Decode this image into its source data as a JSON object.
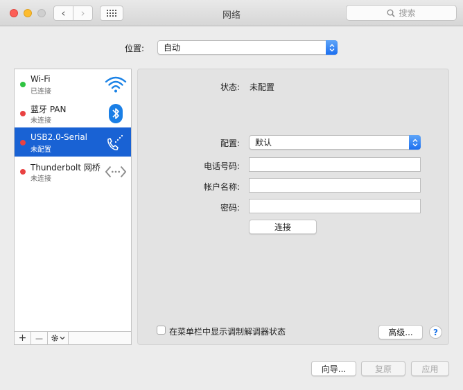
{
  "window": {
    "title": "网络",
    "search_placeholder": "搜索"
  },
  "titlebar_icons": {
    "back": "‹",
    "forward": "›"
  },
  "location": {
    "label": "位置:",
    "value": "自动"
  },
  "services": [
    {
      "name": "Wi-Fi",
      "status": "已连接",
      "status_color": "#2fc442",
      "icon": "wifi-icon"
    },
    {
      "name": "蓝牙 PAN",
      "status": "未连接",
      "status_color": "#e94242",
      "icon": "bluetooth-icon"
    },
    {
      "name": "USB2.0-Serial",
      "status": "未配置",
      "status_color": "#e94242",
      "icon": "phone-modem-icon",
      "selected": true
    },
    {
      "name": "Thunderbolt 网桥",
      "status": "未连接",
      "status_color": "#e94242",
      "icon": "bridge-arrows-icon"
    }
  ],
  "sidebar_tools": {
    "add": "+",
    "remove": "—"
  },
  "detail": {
    "status_label": "状态:",
    "status_value": "未配置",
    "config_label": "配置:",
    "config_value": "默认",
    "phone_label": "电话号码:",
    "phone_value": "",
    "account_label": "帐户名称:",
    "account_value": "",
    "password_label": "密码:",
    "password_value": "",
    "connect_button": "连接",
    "show_modem_status": "在菜单栏中显示调制解调器状态",
    "advanced_button": "高级...",
    "help": "?"
  },
  "footer": {
    "assist_button": "向导...",
    "revert_button": "复原",
    "apply_button": "应用"
  },
  "colors": {
    "selection": "#1962d4",
    "accent": "#1b6ff0"
  }
}
